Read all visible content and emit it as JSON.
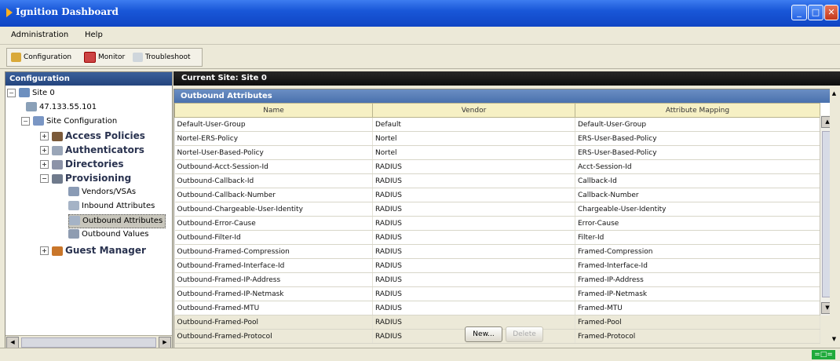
{
  "window": {
    "title": "Ignition Dashboard"
  },
  "menu": {
    "items": [
      "Administration",
      "Help"
    ]
  },
  "toolbar": {
    "buttons": [
      "Configuration",
      "Monitor",
      "Troubleshoot"
    ]
  },
  "left_panel": {
    "title": "Configuration",
    "tree": {
      "site": "Site 0",
      "ip": "47.133.55.101",
      "site_config": "Site Configuration",
      "access_policies": "Access Policies",
      "authenticators": "Authenticators",
      "directories": "Directories",
      "provisioning": "Provisioning",
      "vendors": "Vendors/VSAs",
      "inbound": "Inbound Attributes",
      "outbound": "Outbound Attributes",
      "outbound_values": "Outbound Values",
      "guest_manager": "Guest Manager"
    }
  },
  "main": {
    "current_site": "Current Site: Site 0",
    "panel_title": "Outbound Attributes",
    "columns": [
      "Name",
      "Vendor",
      "Attribute Mapping"
    ],
    "rows": [
      [
        "Default-User-Group",
        "Default",
        "Default-User-Group"
      ],
      [
        "Nortel-ERS-Policy",
        "Nortel",
        "ERS-User-Based-Policy"
      ],
      [
        "Nortel-User-Based-Policy",
        "Nortel",
        "ERS-User-Based-Policy"
      ],
      [
        "Outbound-Acct-Session-Id",
        "RADIUS",
        "Acct-Session-Id"
      ],
      [
        "Outbound-Callback-Id",
        "RADIUS",
        "Callback-Id"
      ],
      [
        "Outbound-Callback-Number",
        "RADIUS",
        "Callback-Number"
      ],
      [
        "Outbound-Chargeable-User-Identity",
        "RADIUS",
        "Chargeable-User-Identity"
      ],
      [
        "Outbound-Error-Cause",
        "RADIUS",
        "Error-Cause"
      ],
      [
        "Outbound-Filter-Id",
        "RADIUS",
        "Filter-Id"
      ],
      [
        "Outbound-Framed-Compression",
        "RADIUS",
        "Framed-Compression"
      ],
      [
        "Outbound-Framed-Interface-Id",
        "RADIUS",
        "Framed-Interface-Id"
      ],
      [
        "Outbound-Framed-IP-Address",
        "RADIUS",
        "Framed-IP-Address"
      ],
      [
        "Outbound-Framed-IP-Netmask",
        "RADIUS",
        "Framed-IP-Netmask"
      ],
      [
        "Outbound-Framed-MTU",
        "RADIUS",
        "Framed-MTU"
      ],
      [
        "Outbound-Framed-Pool",
        "RADIUS",
        "Framed-Pool"
      ],
      [
        "Outbound-Framed-Protocol",
        "RADIUS",
        "Framed-Protocol"
      ]
    ],
    "buttons": {
      "new": "New...",
      "delete": "Delete"
    }
  },
  "status": {
    "connection": "=□="
  },
  "colors": {
    "titlebar": "#1957d8",
    "panel_head": "#24457e",
    "subpanel_head": "#4a71ad",
    "column_header": "#f6f0c4",
    "connection": "#1faa3b"
  }
}
